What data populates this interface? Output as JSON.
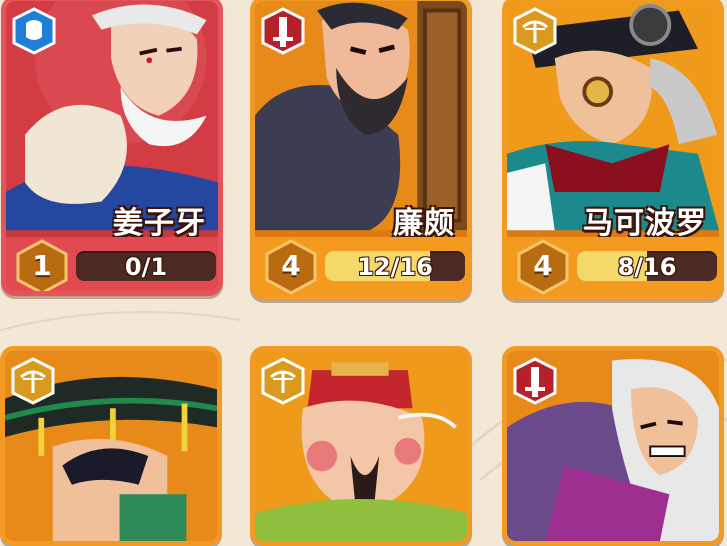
{
  "cards": [
    {
      "name": "姜子牙",
      "level": "1",
      "progress": "0/1",
      "progress_fraction": 0.0,
      "type_icon": "shield-icon",
      "theme": "red"
    },
    {
      "name": "廉颇",
      "level": "4",
      "progress": "12/16",
      "progress_fraction": 0.75,
      "type_icon": "sword-icon",
      "theme": "gold"
    },
    {
      "name": "马可波罗",
      "level": "4",
      "progress": "8/16",
      "progress_fraction": 0.5,
      "type_icon": "crossbow-icon",
      "theme": "gold"
    },
    {
      "name": "",
      "level": "",
      "progress": "",
      "type_icon": "crossbow-icon",
      "theme": "gold"
    },
    {
      "name": "",
      "level": "",
      "progress": "",
      "type_icon": "crossbow-icon",
      "theme": "gold"
    },
    {
      "name": "",
      "level": "",
      "progress": "",
      "type_icon": "sword-icon",
      "theme": "gold"
    }
  ],
  "colors": {
    "red_card": "#c9373f",
    "gold_card": "#dd7a12",
    "background": "#f3e7d6",
    "progress_fill": "#f4d86a"
  }
}
